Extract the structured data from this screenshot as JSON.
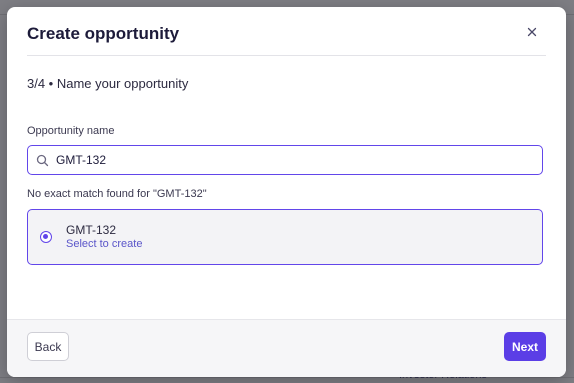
{
  "modal": {
    "title": "Create opportunity",
    "step": "3/4 • Name your opportunity",
    "field_label": "Opportunity name",
    "search_value": "GMT-132",
    "no_match_text": "No exact match found for \"GMT-132\"",
    "option": {
      "title": "GMT-132",
      "subtitle": "Select to create",
      "selected": true
    },
    "back_label": "Back",
    "next_label": "Next"
  },
  "background": {
    "peek_text": "Investor Relations"
  },
  "icons": {
    "close": "close-icon",
    "search": "search-icon"
  },
  "colors": {
    "accent": "#5b3ee6",
    "border_accent": "#6246ea",
    "title": "#1d1b3a",
    "subtitle_link": "#5a55c9"
  }
}
